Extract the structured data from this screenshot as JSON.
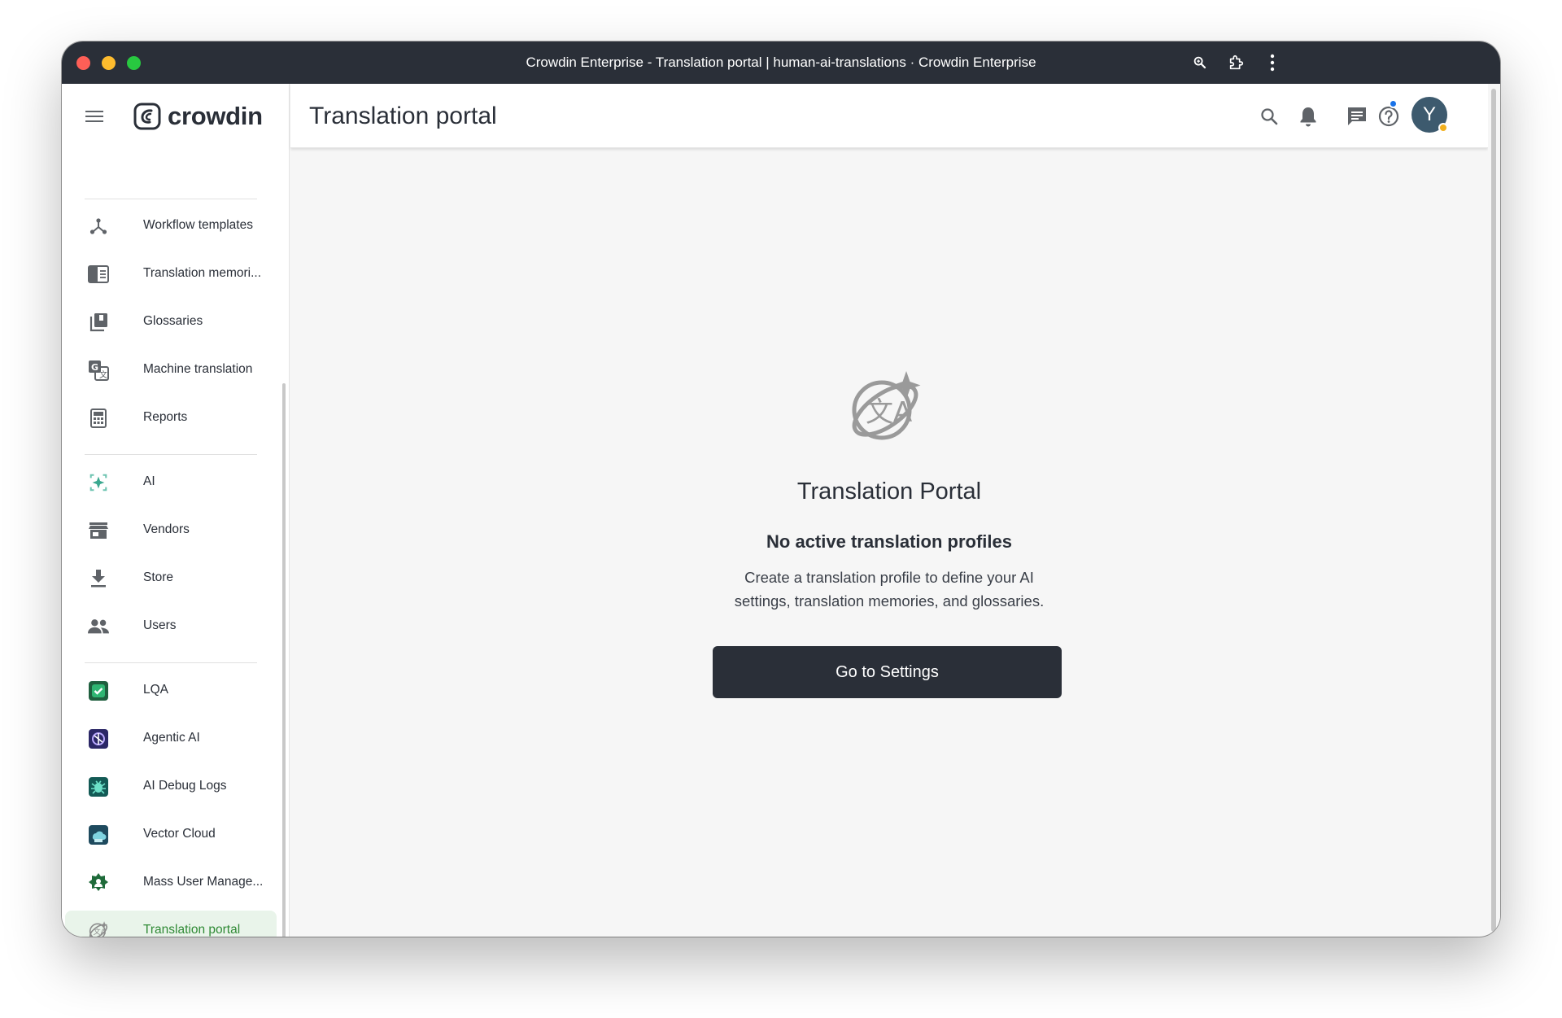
{
  "window": {
    "title": "Crowdin Enterprise - Translation portal | human-ai-translations · Crowdin Enterprise"
  },
  "sidebar": {
    "logo_text": "crowdin",
    "items": [
      {
        "label": "Workflow templates",
        "icon": "workflow-icon"
      },
      {
        "label": "Translation memori...",
        "icon": "translation-memory-icon"
      },
      {
        "label": "Glossaries",
        "icon": "glossaries-icon"
      },
      {
        "label": "Machine translation",
        "icon": "machine-translation-icon"
      },
      {
        "label": "Reports",
        "icon": "reports-icon"
      },
      {
        "label": "AI",
        "icon": "ai-icon"
      },
      {
        "label": "Vendors",
        "icon": "vendors-icon"
      },
      {
        "label": "Store",
        "icon": "store-icon"
      },
      {
        "label": "Users",
        "icon": "users-icon"
      },
      {
        "label": "LQA",
        "icon": "lqa-icon"
      },
      {
        "label": "Agentic AI",
        "icon": "agentic-ai-icon"
      },
      {
        "label": "AI Debug Logs",
        "icon": "ai-debug-logs-icon"
      },
      {
        "label": "Vector Cloud",
        "icon": "vector-cloud-icon"
      },
      {
        "label": "Mass User Manage...",
        "icon": "mass-user-management-icon"
      },
      {
        "label": "Translation portal",
        "icon": "translation-portal-icon",
        "active": true
      }
    ]
  },
  "header": {
    "title": "Translation portal",
    "avatar_initial": "Y"
  },
  "empty_state": {
    "title": "Translation Portal",
    "subtitle": "No active translation profiles",
    "description": "Create a translation profile to define your AI settings, translation memories, and glossaries.",
    "button_label": "Go to Settings"
  },
  "colors": {
    "titlebar": "#2a2f38",
    "active_nav_bg": "#e9f4ea",
    "active_nav_text": "#2f8a35",
    "primary_button": "#2a2f38",
    "notification_dot": "#1a73e8",
    "status_dot": "#f2b01e"
  }
}
